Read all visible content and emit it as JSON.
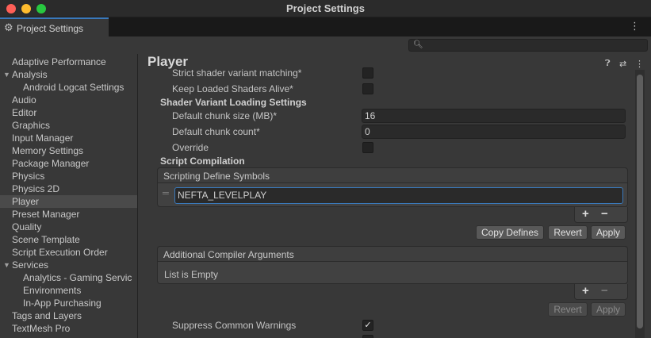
{
  "window": {
    "title": "Project Settings"
  },
  "tab": {
    "label": "Project Settings",
    "menu_glyph": "⋮"
  },
  "search": {
    "placeholder": ""
  },
  "sidebar": {
    "items": [
      {
        "label": "Adaptive Performance",
        "indent": 0
      },
      {
        "label": "Analysis",
        "indent": 0,
        "expanded": true
      },
      {
        "label": "Android Logcat Settings",
        "indent": 1
      },
      {
        "label": "Audio",
        "indent": 0
      },
      {
        "label": "Editor",
        "indent": 0
      },
      {
        "label": "Graphics",
        "indent": 0
      },
      {
        "label": "Input Manager",
        "indent": 0
      },
      {
        "label": "Memory Settings",
        "indent": 0
      },
      {
        "label": "Package Manager",
        "indent": 0
      },
      {
        "label": "Physics",
        "indent": 0
      },
      {
        "label": "Physics 2D",
        "indent": 0
      },
      {
        "label": "Player",
        "indent": 0,
        "selected": true
      },
      {
        "label": "Preset Manager",
        "indent": 0
      },
      {
        "label": "Quality",
        "indent": 0
      },
      {
        "label": "Scene Template",
        "indent": 0
      },
      {
        "label": "Script Execution Order",
        "indent": 0
      },
      {
        "label": "Services",
        "indent": 0,
        "expanded": true
      },
      {
        "label": "Analytics - Gaming Servic",
        "indent": 1
      },
      {
        "label": "Environments",
        "indent": 1
      },
      {
        "label": "In-App Purchasing",
        "indent": 1
      },
      {
        "label": "Tags and Layers",
        "indent": 0
      },
      {
        "label": "TextMesh Pro",
        "indent": 0
      }
    ]
  },
  "main": {
    "title": "Player",
    "strict_shader": {
      "label": "Strict shader variant matching*",
      "checked": false
    },
    "keep_shaders": {
      "label": "Keep Loaded Shaders Alive*",
      "checked": false
    },
    "svl_section": "Shader Variant Loading Settings",
    "chunk_size": {
      "label": "Default chunk size (MB)*",
      "value": "16"
    },
    "chunk_count": {
      "label": "Default chunk count*",
      "value": "0"
    },
    "override": {
      "label": "Override",
      "checked": false
    },
    "script_section": "Script Compilation",
    "define_symbols": {
      "header": "Scripting Define Symbols",
      "items": [
        "NEFTA_LEVELPLAY"
      ]
    },
    "defines_buttons": {
      "copy": "Copy Defines",
      "revert": "Revert",
      "apply": "Apply"
    },
    "compiler_args": {
      "header": "Additional Compiler Arguments",
      "empty_text": "List is Empty"
    },
    "args_buttons": {
      "revert": "Revert",
      "apply": "Apply"
    },
    "plus": "+",
    "minus": "−",
    "suppress": {
      "label": "Suppress Common Warnings",
      "checked": true
    }
  }
}
